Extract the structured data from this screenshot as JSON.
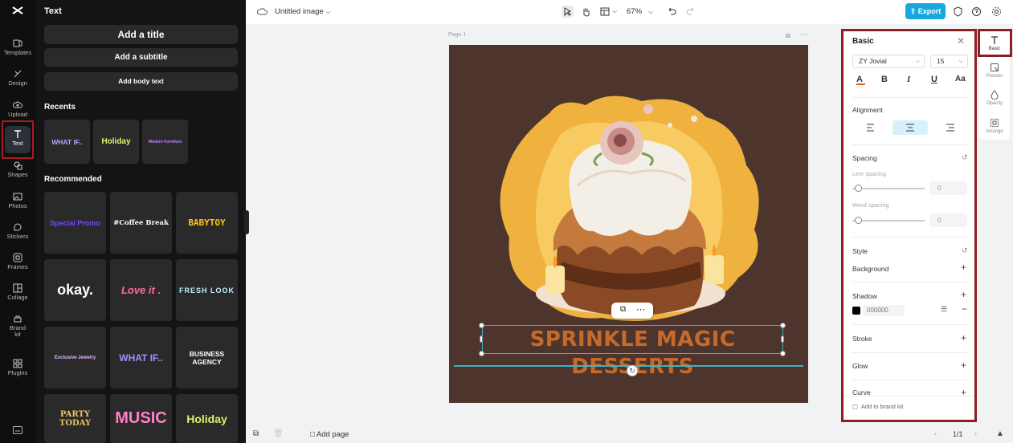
{
  "rail": {
    "items": [
      {
        "label": "Templates"
      },
      {
        "label": "Design"
      },
      {
        "label": "Upload"
      },
      {
        "label": "Text"
      },
      {
        "label": "Shapes"
      },
      {
        "label": "Photos"
      },
      {
        "label": "Stickers"
      },
      {
        "label": "Frames"
      },
      {
        "label": "Collage"
      },
      {
        "label": "Brand kit"
      },
      {
        "label": "Plugins"
      }
    ]
  },
  "text_panel": {
    "title": "Text",
    "add_title": "Add a title",
    "add_subtitle": "Add a subtitle",
    "add_body": "Add body text",
    "recents_heading": "Recents",
    "recents": [
      "WHAT IF..",
      "Holiday",
      "Modern Furniture"
    ],
    "recommended_heading": "Recommended",
    "recommended": [
      "Special Promo",
      "#Coffee Break",
      "BABYTOY",
      "okay.",
      "Love it .",
      "FRESH LOOK",
      "Exclusive Jewelry",
      "WHAT IF..",
      "BUSINESS AGENCY",
      "PARTY TODAY",
      "MUSIC",
      "Holiday"
    ]
  },
  "topbar": {
    "doc_name": "Untitled image",
    "zoom": "67%",
    "export_label": "Export"
  },
  "canvas": {
    "page_label": "Page 1",
    "text": "SPRINKLE MAGIC DESSERTS",
    "bg_color": "#4d342c",
    "text_color": "#c66a2c"
  },
  "bottombar": {
    "add_page": "Add page",
    "page_indicator": "1/1"
  },
  "props": {
    "title": "Basic",
    "font": "ZY Jovial",
    "size": "15",
    "alignment_label": "Alignment",
    "spacing_label": "Spacing",
    "line_spacing_label": "Line spacing",
    "line_spacing_value": "0",
    "word_spacing_label": "Word spacing",
    "word_spacing_value": "0",
    "style_label": "Style",
    "background_label": "Background",
    "shadow_label": "Shadow",
    "shadow_color": "000000",
    "stroke_label": "Stroke",
    "glow_label": "Glow",
    "curve_label": "Curve",
    "add_brand_kit": "Add to brand kit"
  },
  "right_rail": {
    "items": [
      {
        "label": "Basic"
      },
      {
        "label": "Presets"
      },
      {
        "label": "Opacity"
      },
      {
        "label": "Arrange"
      }
    ]
  },
  "colors": {
    "accent": "#19a7e0",
    "highlight": "#8b1f23",
    "selection": "#3bb4c4"
  }
}
